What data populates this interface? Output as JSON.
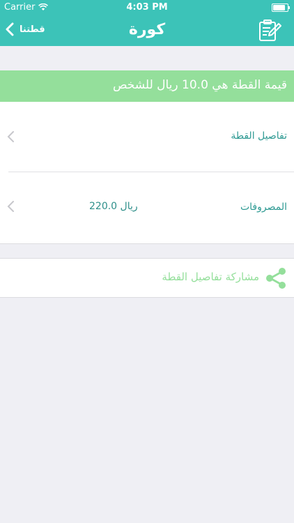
{
  "status_bar": {
    "carrier": "Carrier",
    "time": "4:03 PM"
  },
  "nav": {
    "title": "كورة",
    "back_label": "قطتنا"
  },
  "banner": {
    "text": "قيمة القطة هي 10.0 ريال للشخص"
  },
  "details": {
    "row1_label": "تفاصيل القطة",
    "row2_label": "المصروفات",
    "row2_value": "220.0 ريال"
  },
  "share": {
    "label": "مشاركة تفاصيل القطة"
  },
  "colors": {
    "primary": "#3cc3b8",
    "banner": "#94df9b",
    "text_accent": "#2e9a93",
    "background": "#efeff4"
  }
}
